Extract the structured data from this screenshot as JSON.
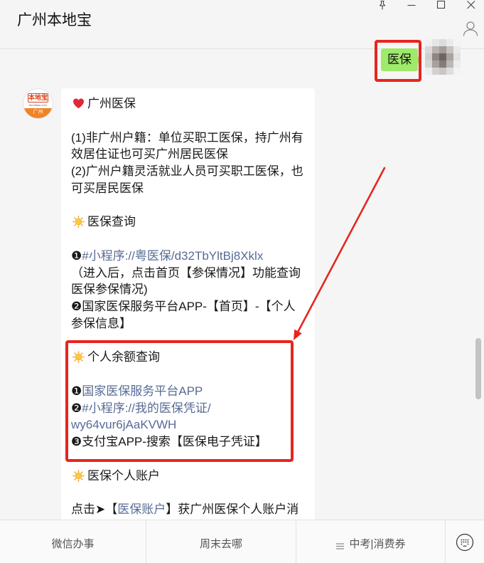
{
  "window": {
    "title": "广州本地宝",
    "controls": [
      "pin-icon",
      "minimize-icon",
      "maximize-icon",
      "close-icon"
    ],
    "profile_icon": "person-icon"
  },
  "outgoing_message": {
    "text": "医保"
  },
  "account_avatar": {
    "logo_name": "本地宝",
    "logo_site": "bendibao.com",
    "logo_city": "广州"
  },
  "message": {
    "sections": [
      {
        "icon": "heart-icon",
        "title": "广州医保",
        "lines": [
          "(1)非广州户籍：单位买职工医保，持广州有",
          "效居住证也可买广州居民医保",
          "(2)广州户籍灵活就业人员可买职工医保，也",
          "可买居民医保"
        ]
      },
      {
        "icon": "sun-icon",
        "title": "医保查询",
        "item1": {
          "num": "❶",
          "link": "#小程序://粤医保/d32TbYltBj8Xklx"
        },
        "item1_note": [
          "（进入后，点击首页【参保情况】功能查询",
          "医保参保情况)"
        ],
        "item2": [
          "❷国家医保服务平台APP-【首页】-【个人",
          "参保信息】"
        ]
      },
      {
        "icon": "sun-icon",
        "title": "个人余额查询",
        "item1": {
          "num": "❶",
          "link": "国家医保服务平台APP"
        },
        "item2": {
          "num": "❷",
          "link": [
            "#小程序://我的医保凭证/",
            "wy64vur6jAaKVWH"
          ]
        },
        "item3": "❸支付宝APP-搜索【医保电子凭证】"
      },
      {
        "icon": "sun-icon",
        "title": "医保个人账户",
        "line": {
          "prefix": "点击➤【",
          "link": "医保账户",
          "suffix": "】获广州医保个人账户消"
        }
      }
    ]
  },
  "bottom_menu": {
    "items": [
      {
        "label": "微信办事"
      },
      {
        "label": "周末去哪"
      },
      {
        "label": "中考|消费券",
        "icon": "menu-icon"
      }
    ],
    "keyboard_icon": "keyboard-icon"
  },
  "colors": {
    "sent_bubble": "#9eea6a",
    "link": "#576b95",
    "annotation_red": "#e5261f",
    "chat_background": "#f5f5f5"
  }
}
